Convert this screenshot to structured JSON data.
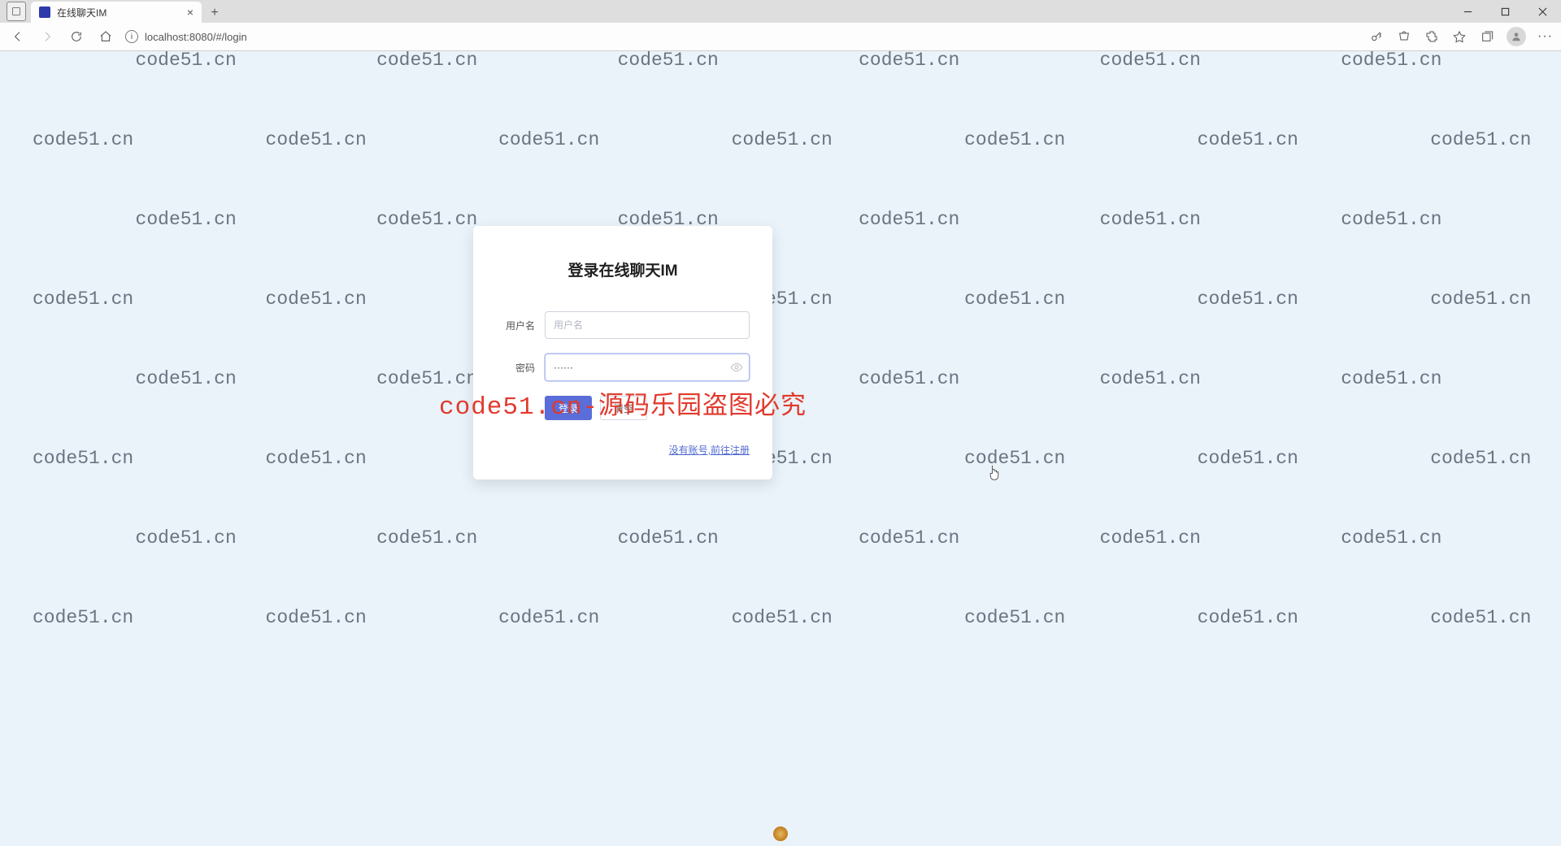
{
  "browser": {
    "tab_title": "在线聊天IM",
    "url": "localhost:8080/#/login"
  },
  "watermark": {
    "text": "code51.cn",
    "red_text": "code51.cn-源码乐园盗图必究"
  },
  "login": {
    "title": "登录在线聊天IM",
    "username_label": "用户名",
    "username_placeholder": "用户名",
    "username_value": "",
    "password_label": "密码",
    "password_value": "······",
    "login_btn": "登录",
    "clear_btn": "清空",
    "register_link": "没有账号,前往注册"
  }
}
